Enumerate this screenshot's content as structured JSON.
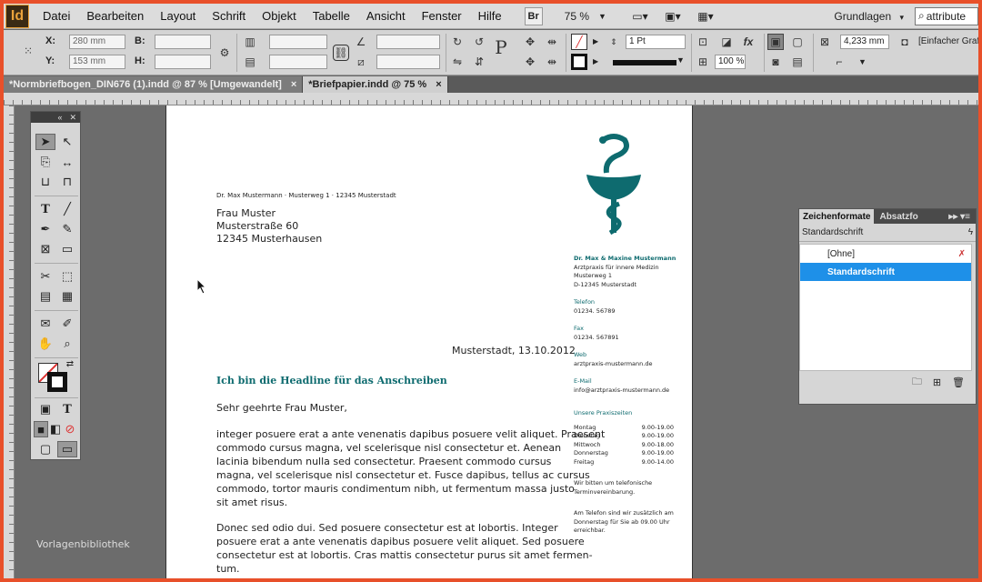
{
  "app": {
    "logo": "Id"
  },
  "menu": [
    "Datei",
    "Bearbeiten",
    "Layout",
    "Schrift",
    "Objekt",
    "Tabelle",
    "Ansicht",
    "Fenster",
    "Hilfe"
  ],
  "menubar": {
    "bridge": "Br",
    "zoom": "75 %",
    "workspace": "Grundlagen",
    "search_value": "attribute"
  },
  "control": {
    "x_label": "X:",
    "x_value": "280 mm",
    "y_label": "Y:",
    "y_value": "153 mm",
    "w_label": "B:",
    "h_label": "H:",
    "stroke_weight": "1 Pt",
    "scale": "100 %",
    "offset": "4,233 mm",
    "frame_style": "[Einfacher Grafi"
  },
  "tabs": [
    {
      "label": "*Normbriefbogen_DIN676 (1).indd @ 87 % [Umgewandelt]",
      "close": "×"
    },
    {
      "label": "*Briefpapier.indd @ 75 %",
      "close": "×"
    }
  ],
  "letter": {
    "sender_line": "Dr. Max  Mustermann · Musterweg 1 · 12345 Musterstadt",
    "recipient": [
      "Frau Muster",
      "Musterstraße 60",
      "12345 Musterhausen"
    ],
    "date": "Musterstadt, 13.10.2012",
    "headline": "Ich bin die Headline für das Anschreiben",
    "salutation": "Sehr geehrte Frau Muster,",
    "para1": [
      "integer posuere erat a ante venenatis dapibus posuere velit aliquet. Praesent",
      "commodo cursus magna, vel scelerisque nisl consectetur et. Aenean",
      "lacinia bibendum nulla sed consectetur. Praesent commodo cursus",
      "magna, vel scelerisque nisl consectetur et. Fusce dapibus, tellus ac cursus",
      "commodo, tortor mauris condimentum nibh, ut fermentum massa justo",
      "sit amet risus."
    ],
    "para2": [
      "Donec sed odio dui. Sed posuere consectetur est at lobortis. Integer",
      "posuere erat a ante venenatis dapibus posuere velit aliquet. Sed posuere",
      "consectetur est at lobortis. Cras mattis consectetur purus sit amet fermen-",
      "tum."
    ]
  },
  "sidebar": {
    "name": "Dr. Max & Maxine Mustermann",
    "address": [
      "Arztpraxis für innere Medizin",
      "Musterweg 1",
      "D-12345 Musterstadt"
    ],
    "phone_label": "Telefon",
    "phone": "01234. 56789",
    "fax_label": "Fax",
    "fax": "01234. 567891",
    "web_label": "Web",
    "web": "arztpraxis-mustermann.de",
    "mail_label": "E-Mail",
    "mail": "info@arztpraxis-mustermann.de",
    "hours_label": "Unsere Praxiszeiten",
    "hours": [
      {
        "day": "Montag",
        "time": "9.00-19.00"
      },
      {
        "day": "Dienstag",
        "time": "9.00-19.00"
      },
      {
        "day": "Mittwoch",
        "time": "9.00-18.00"
      },
      {
        "day": "Donnerstag",
        "time": "9.00-19.00"
      },
      {
        "day": "Freitag",
        "time": "9.00-14.00"
      }
    ],
    "note1": [
      "Wir bitten um telefonische",
      "Terminvereinbarung."
    ],
    "note2": [
      "Am Telefon sind wir zusätzlich am",
      "Donnerstag für Sie ab 09.00 Uhr",
      "erreichbar."
    ]
  },
  "char_panel": {
    "tab_active": "Zeichenformate",
    "tab_inactive": "Absatzfo",
    "current": "Standardschrift",
    "items": [
      "[Ohne]",
      "Standardschrift"
    ]
  },
  "watermark": "Vorlagenbibliothek",
  "colors": {
    "accent": "#0e6b6f",
    "selection": "#1e90e8",
    "frame": "#e8502a"
  }
}
